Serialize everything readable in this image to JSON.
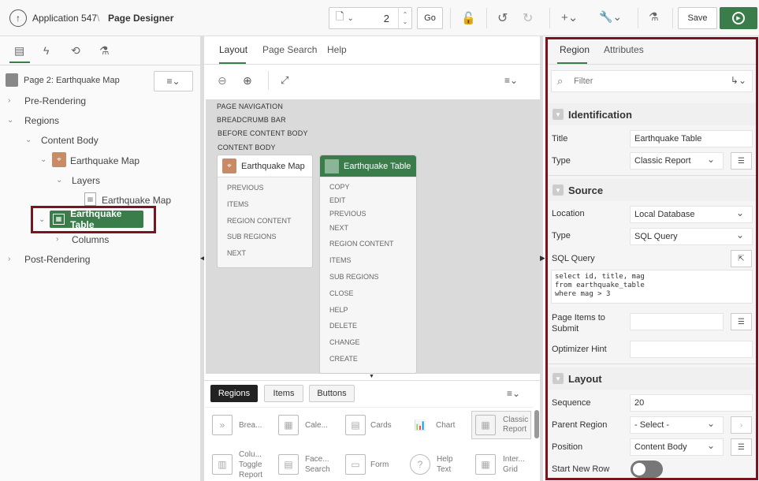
{
  "header": {
    "app_name": "Application 547",
    "page_designer": "Page Designer",
    "page_number": "2",
    "go_label": "Go",
    "save_label": "Save"
  },
  "left_tree": {
    "page_title": "Page 2: Earthquake Map",
    "pre_rendering": "Pre-Rendering",
    "regions": "Regions",
    "content_body": "Content Body",
    "earthquake_map": "Earthquake Map",
    "layers": "Layers",
    "earthquake_map_layer": "Earthquake Map",
    "earthquake_table": "Earthquake Table",
    "columns": "Columns",
    "post_rendering": "Post-Rendering"
  },
  "middle": {
    "tabs": [
      "Layout",
      "Page Search",
      "Help"
    ],
    "canvas_labels": [
      "PAGE NAVIGATION",
      "BREADCRUMB BAR",
      "BEFORE CONTENT BODY",
      "CONTENT BODY"
    ],
    "map_card": {
      "title": "Earthquake Map",
      "items": [
        "PREVIOUS",
        "ITEMS",
        "REGION CONTENT",
        "SUB REGIONS",
        "NEXT"
      ]
    },
    "table_card": {
      "title": "Earthquake Table",
      "items": [
        "COPY",
        "EDIT",
        "PREVIOUS",
        "NEXT",
        "REGION CONTENT",
        "ITEMS",
        "SUB REGIONS",
        "CLOSE",
        "HELP",
        "DELETE",
        "CHANGE",
        "CREATE"
      ]
    },
    "gallery_tabs": [
      "Regions",
      "Items",
      "Buttons"
    ],
    "gallery_items_row1": [
      "Brea...",
      "Cale...",
      "Cards",
      "Chart",
      "Classic Report"
    ],
    "gallery_items_row2": [
      "Colu... Toggle Report",
      "Face... Search",
      "Form",
      "Help Text",
      "Inter... Grid"
    ]
  },
  "right": {
    "tabs": [
      "Region",
      "Attributes"
    ],
    "filter_placeholder": "Filter",
    "identification": {
      "heading": "Identification",
      "title_label": "Title",
      "title_value": "Earthquake Table",
      "type_label": "Type",
      "type_value": "Classic Report"
    },
    "source": {
      "heading": "Source",
      "location_label": "Location",
      "location_value": "Local Database",
      "type_label": "Type",
      "type_value": "SQL Query",
      "sql_label": "SQL Query",
      "sql_line1": "select id, title, mag",
      "sql_line2": "from earthquake_table",
      "sql_line3": "where mag > 3",
      "page_items_label": "Page Items to Submit",
      "optimizer_label": "Optimizer Hint"
    },
    "layout": {
      "heading": "Layout",
      "sequence_label": "Sequence",
      "sequence_value": "20",
      "parent_label": "Parent Region",
      "parent_value": "- Select -",
      "position_label": "Position",
      "position_value": "Content Body",
      "start_new_row_label": "Start New Row"
    }
  }
}
